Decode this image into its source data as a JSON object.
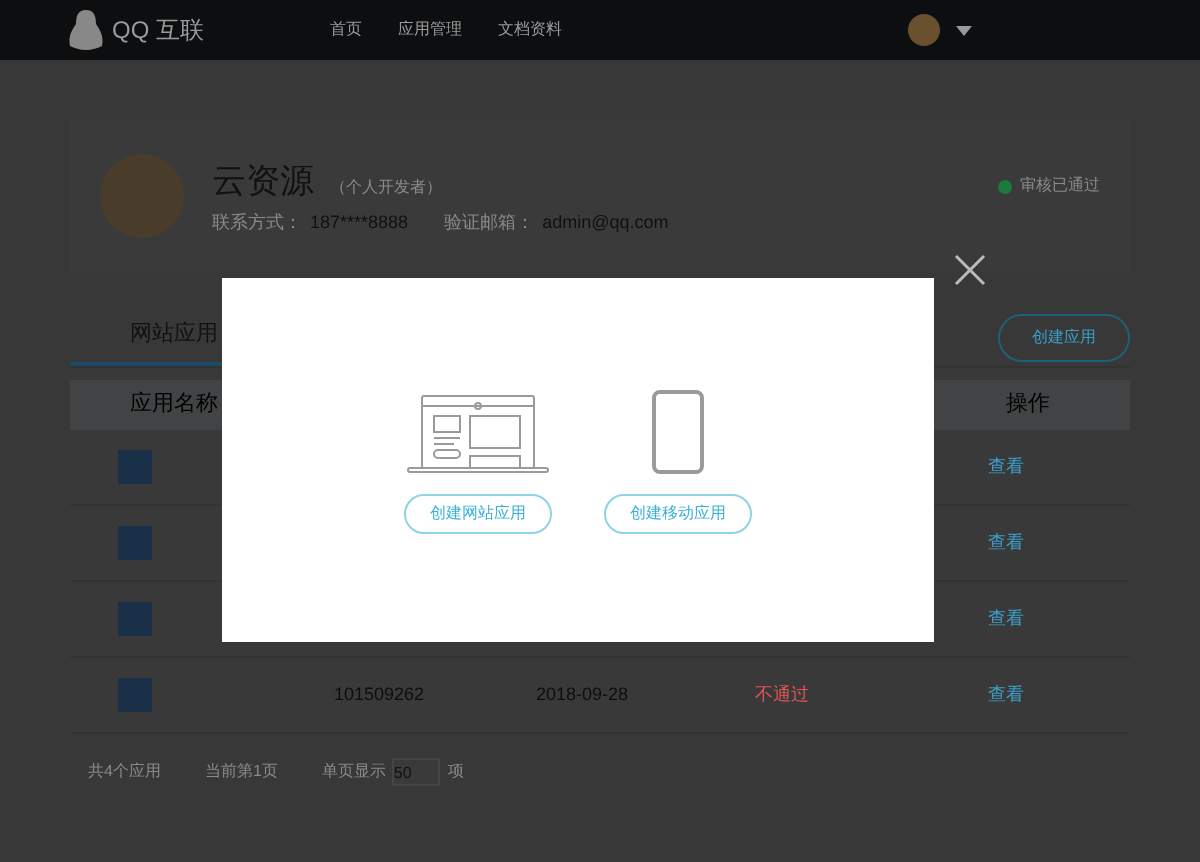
{
  "navbar": {
    "logo": "QQ 互联",
    "links": [
      {
        "label": "首页"
      },
      {
        "label": "应用管理"
      },
      {
        "label": "文档资料"
      }
    ]
  },
  "profile": {
    "name": "云资源",
    "role": "（个人开发者）",
    "contact_label": "联系方式：",
    "contact": "187****8888",
    "email_label": "验证邮箱：",
    "email": "admin@qq.com",
    "status": "审核已通过",
    "verified": true
  },
  "tabs": [
    {
      "label": "网站应用",
      "selected": true
    }
  ],
  "create_button": "创建应用",
  "table": {
    "columns": [
      "应用名称",
      "操作"
    ],
    "rows": [
      {
        "action": "查看"
      },
      {
        "action": "查看"
      },
      {
        "action": "查看"
      },
      {
        "id": "101509262",
        "date": "2018-09-28",
        "status": "不通过",
        "rejected": true,
        "action": "查看"
      }
    ]
  },
  "footer": {
    "total": "共4个应用",
    "page": "当前第1页",
    "per_page_label": "单页显示",
    "per_page": "50",
    "unit": "项"
  },
  "dialog": {
    "options": [
      {
        "kind": "web",
        "label": "创建网站应用"
      },
      {
        "kind": "mobile",
        "label": "创建移动应用"
      }
    ]
  }
}
